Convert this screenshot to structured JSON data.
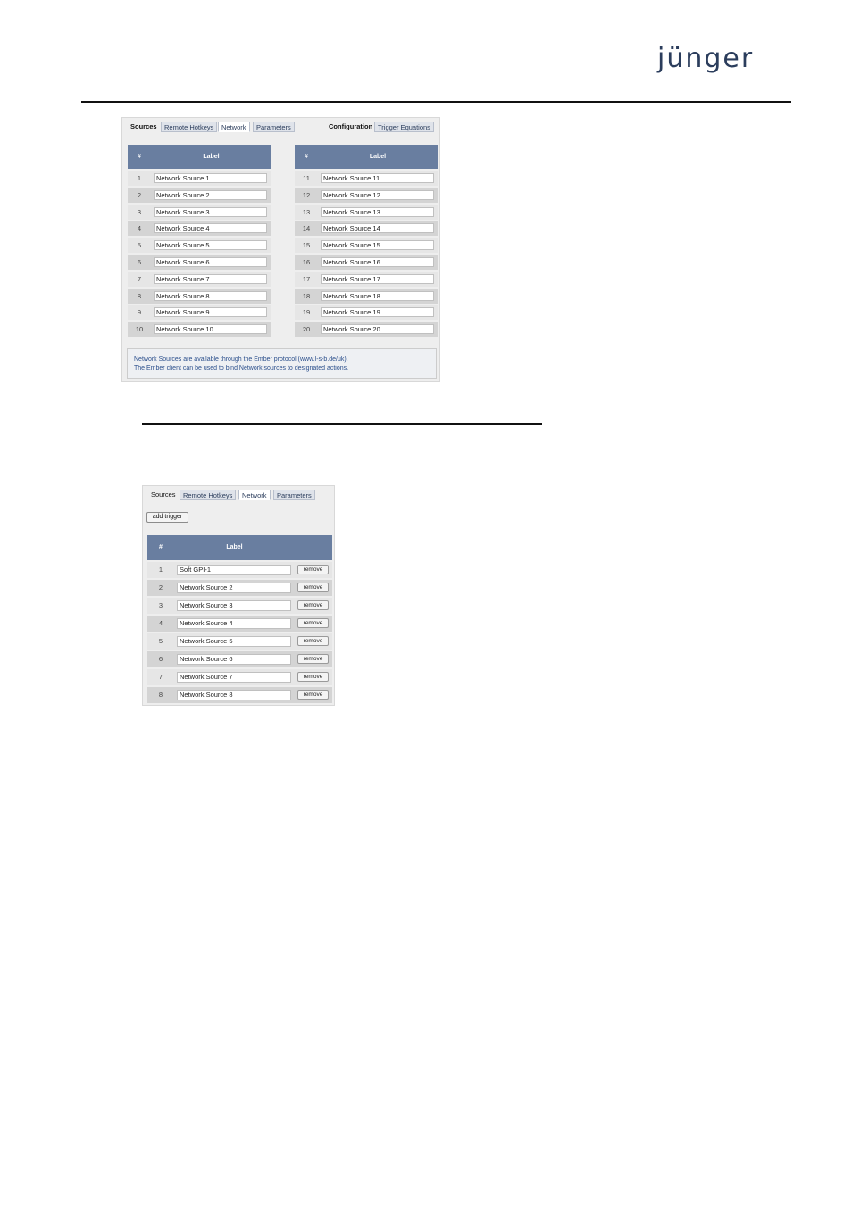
{
  "brand": {
    "logo_text": "jünger",
    "logo_color": "#2b3d5c"
  },
  "panel_network": {
    "tabs_left": [
      "Sources",
      "Remote Hotkeys",
      "Network",
      "Parameters"
    ],
    "tabs_right": [
      "Configuration",
      "Trigger Equations"
    ],
    "active_tab": "Network",
    "col_num": "#",
    "col_label": "Label",
    "left_rows": [
      {
        "num": "1",
        "label": "Network Source 1"
      },
      {
        "num": "2",
        "label": "Network Source 2"
      },
      {
        "num": "3",
        "label": "Network Source 3"
      },
      {
        "num": "4",
        "label": "Network Source 4"
      },
      {
        "num": "5",
        "label": "Network Source 5"
      },
      {
        "num": "6",
        "label": "Network Source 6"
      },
      {
        "num": "7",
        "label": "Network Source 7"
      },
      {
        "num": "8",
        "label": "Network Source 8"
      },
      {
        "num": "9",
        "label": "Network Source 9"
      },
      {
        "num": "10",
        "label": "Network Source 10"
      }
    ],
    "right_rows": [
      {
        "num": "11",
        "label": "Network Source 11"
      },
      {
        "num": "12",
        "label": "Network Source 12"
      },
      {
        "num": "13",
        "label": "Network Source 13"
      },
      {
        "num": "14",
        "label": "Network Source 14"
      },
      {
        "num": "15",
        "label": "Network Source 15"
      },
      {
        "num": "16",
        "label": "Network Source 16"
      },
      {
        "num": "17",
        "label": "Network Source 17"
      },
      {
        "num": "18",
        "label": "Network Source 18"
      },
      {
        "num": "19",
        "label": "Network Source 19"
      },
      {
        "num": "20",
        "label": "Network Source 20"
      }
    ],
    "info_line1": "Network Sources are available through the Ember protocol (www.l-s-b.de/uk).",
    "info_line2": "The Ember client can be used to bind Network sources to designated actions."
  },
  "panel_triggers": {
    "tabs": [
      "Sources",
      "Remote Hotkeys",
      "Network",
      "Parameters"
    ],
    "active_tab": "Network",
    "add_trigger_label": "add trigger",
    "col_num": "#",
    "col_label": "Label",
    "remove_label": "remove",
    "rows": [
      {
        "num": "1",
        "label": "Soft GPI-1"
      },
      {
        "num": "2",
        "label": "Network Source 2"
      },
      {
        "num": "3",
        "label": "Network Source 3"
      },
      {
        "num": "4",
        "label": "Network Source 4"
      },
      {
        "num": "5",
        "label": "Network Source 5"
      },
      {
        "num": "6",
        "label": "Network Source 6"
      },
      {
        "num": "7",
        "label": "Network Source 7"
      },
      {
        "num": "8",
        "label": "Network Source 8"
      }
    ]
  },
  "colors": {
    "table_header": "#697ea0",
    "panel_bg": "#eeeeee",
    "info_text": "#2b4f8c"
  }
}
